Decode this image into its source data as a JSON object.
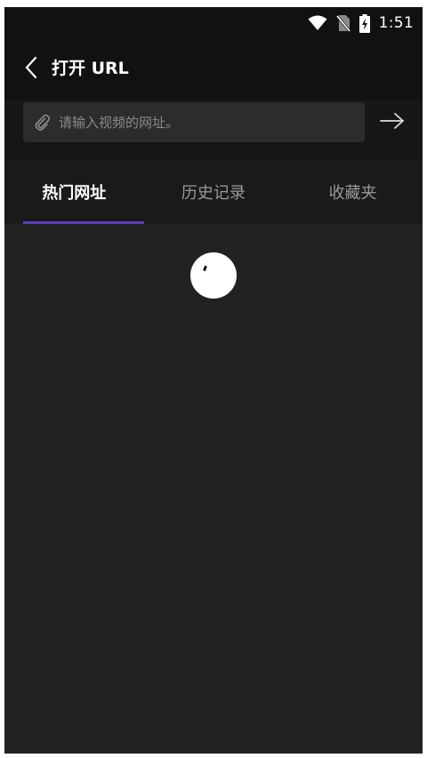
{
  "status_bar": {
    "time": "1:51",
    "icons": [
      "wifi-icon",
      "no-sim-icon",
      "battery-charging-icon"
    ]
  },
  "header": {
    "back_icon": "chevron-left-icon",
    "title": "打开 URL"
  },
  "url_bar": {
    "icon": "link-icon",
    "value": "",
    "placeholder": "请输入视频的网址。",
    "go_icon": "arrow-right-icon"
  },
  "tabs": [
    {
      "label": "热门网址",
      "active": true
    },
    {
      "label": "历史记录",
      "active": false
    },
    {
      "label": "收藏夹",
      "active": false
    }
  ],
  "colors": {
    "accent": "#5b3fbf",
    "background": "#222222",
    "header_background": "#111111"
  },
  "content": {
    "state": "loading",
    "indicator_icon": "loading-spinner-icon"
  }
}
